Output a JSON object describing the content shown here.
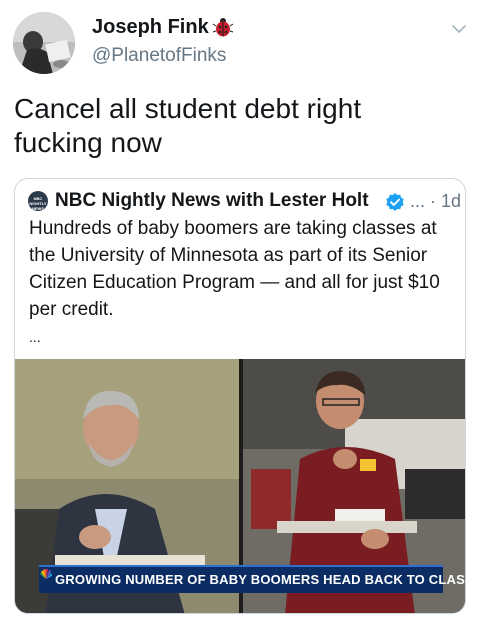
{
  "author": {
    "name": "Joseph Fink",
    "handle": "@PlanetofFinks",
    "badge_icon": "ladybug-icon",
    "badge_color": "#c81e2a"
  },
  "tweet": {
    "text": "Cancel all student debt right fucking now"
  },
  "quoted": {
    "logo_text": "NBC NIGHTLY NEWS",
    "name": "NBC Nightly News with Lester Holt",
    "verified_color": "#1da1f2",
    "meta": "... · 1d",
    "text": "Hundreds of baby boomers are taking classes at the University of Minnesota as part of its Senior Citizen Education Program — and all for just $10 per credit.",
    "ellipsis": "...",
    "video": {
      "lower_third": "GROWING NUMBER OF BABY BOOMERS HEAD BACK TO CLASS",
      "lower_third_color": "#0b2d63"
    }
  },
  "icons": {
    "menu": "chevron-down-icon",
    "verified": "verified-badge-icon",
    "network": "peacock-icon"
  }
}
